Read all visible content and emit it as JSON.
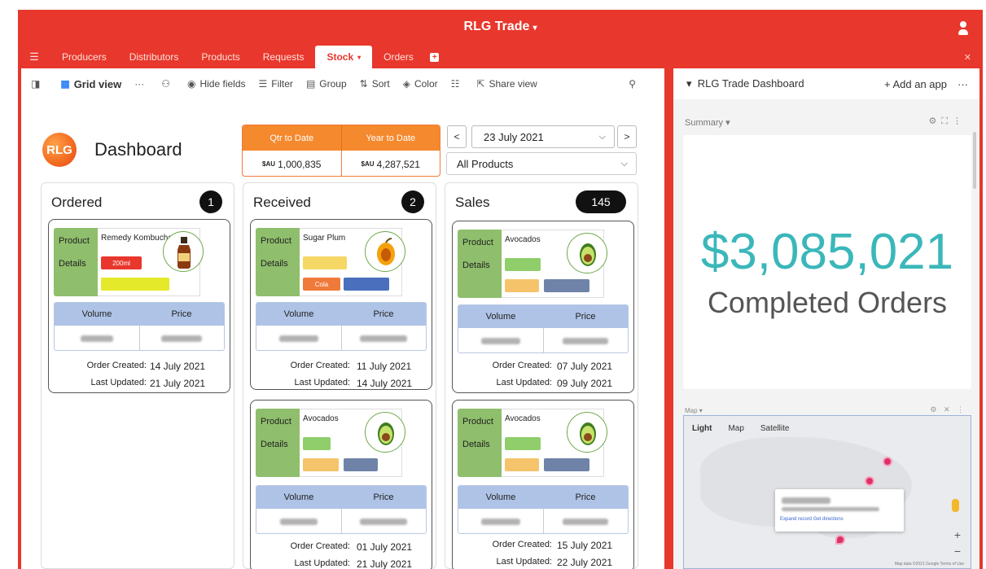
{
  "app": {
    "title": "RLG Trade",
    "title_caret": "▾"
  },
  "tabs": [
    {
      "label": "Producers"
    },
    {
      "label": "Distributors"
    },
    {
      "label": "Products"
    },
    {
      "label": "Requests"
    },
    {
      "label": "Stock",
      "active": true,
      "caret": "▾"
    },
    {
      "label": "Orders"
    }
  ],
  "toolbar": {
    "grid_view": "Grid view",
    "hide_fields": "Hide fields",
    "filter": "Filter",
    "group": "Group",
    "sort": "Sort",
    "color": "Color",
    "share_view": "Share view"
  },
  "dashboard": {
    "logo_text": "RLG",
    "title": "Dashboard",
    "kpi": {
      "qtr_label": "Qtr to Date",
      "year_label": "Year to Date",
      "currency": "$AU",
      "qtr_value": "1,000,835",
      "year_value": "4,287,521"
    },
    "prev": "<",
    "next": ">",
    "date": "23 July 2021",
    "product_filter": "All Products"
  },
  "labels": {
    "product": "Product",
    "details": "Details",
    "volume": "Volume",
    "price": "Price",
    "order_created": "Order Created:",
    "last_updated": "Last Updated:"
  },
  "columns": [
    {
      "title": "Ordered",
      "count": "1",
      "cards": [
        {
          "product": "Remedy Kombucha",
          "chip": "200ml",
          "created": "14 July 2021",
          "updated": "21 July 2021"
        }
      ]
    },
    {
      "title": "Received",
      "count": "2",
      "cards": [
        {
          "product": "Sugar Plum",
          "chip": "Cola",
          "created": "11 July 2021",
          "updated": "14 July 2021"
        },
        {
          "product": "Avocados",
          "created": "01 July 2021",
          "updated": "21 July 2021"
        }
      ]
    },
    {
      "title": "Sales",
      "count": "145",
      "cards": [
        {
          "product": "Avocados",
          "created": "07 July 2021",
          "updated": "09 July 2021"
        },
        {
          "product": "Avocados",
          "created": "15 July 2021",
          "updated": "22 July 2021"
        }
      ]
    }
  ],
  "right_panel": {
    "title": "RLG Trade Dashboard",
    "add_app": "+ Add an app",
    "summary_label": "Summary",
    "summary_value": "$3,085,021",
    "summary_caption": "Completed Orders",
    "map_label": "Map",
    "map_tabs": [
      "Light",
      "Map",
      "Satellite"
    ],
    "map_link": "Expand record   Get directions",
    "map_footer": "Map data ©2021 Google   Terms of Use"
  },
  "colors": {
    "brand_red": "#e8372c",
    "accent_orange": "#f5892e",
    "summary_teal": "#3bb7ba",
    "product_green": "#8fbe6c",
    "table_blue": "#aec3e6"
  }
}
